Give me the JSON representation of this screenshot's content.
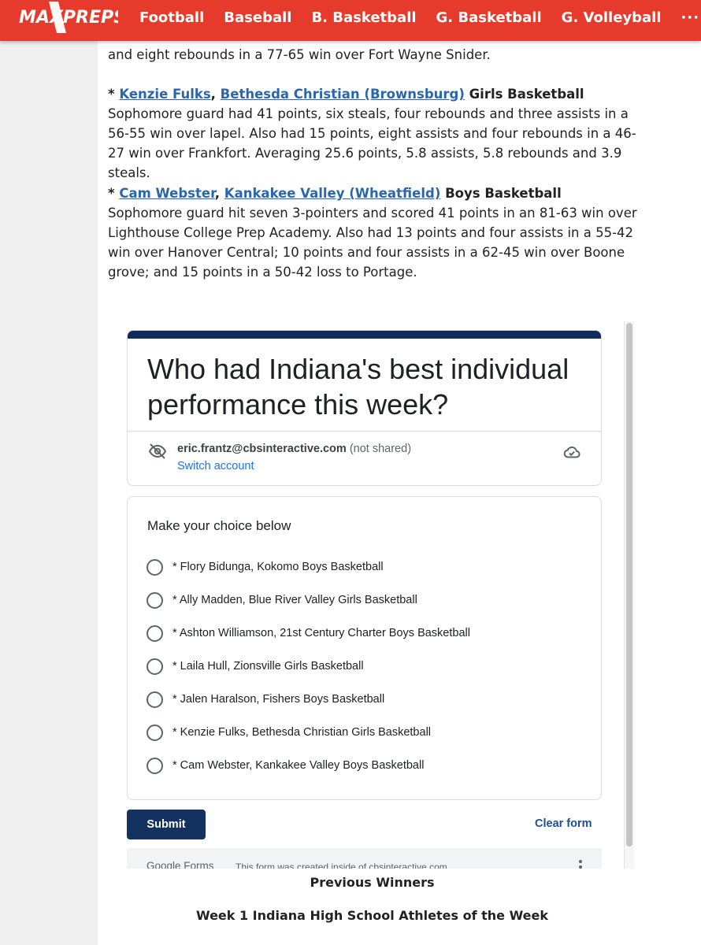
{
  "nav": {
    "logo": "MAXPREPS",
    "items": [
      "Football",
      "Baseball",
      "B. Basketball",
      "G. Basketball",
      "G. Volleyball"
    ],
    "more": "···"
  },
  "article": {
    "top_line": "and eight rebounds in a 77-65 win over Fort Wayne Snider.",
    "entries": [
      {
        "prefix": "* ",
        "athlete": "Kenzie Fulks",
        "sep": ", ",
        "school": "Bethesda Christian (Brownsburg)",
        "sport": " Girls Basketball",
        "text": "Sophomore guard had 41 points, six steals, four rebounds and three assists in a 56-55 win over lapel. Also had 15 points, eight assists and four rebounds in a 46-27 win over Frankfort. Averaging 25.6 points, 5.8 assists, 5.8 rebounds and 3.9 steals."
      },
      {
        "prefix": "* ",
        "athlete": "Cam Webster",
        "sep": ", ",
        "school": "Kankakee Valley (Wheatfield)",
        "sport": " Boys Basketball",
        "text": "Sophomore guard hit seven 3-pointers and scored 41 points in an 81-63 win over Lighthouse College Prep Academy. Also had 13 points and four assists in a 55-42 win over Hanover Central; 10 points and four assists in a 62-45 win over Boone grove; and 15 points in a 50-42 loss to Portage."
      }
    ]
  },
  "form": {
    "title": "Who had Indiana's best individual performance this week?",
    "account_email": "eric.frantz@cbsinteractive.com",
    "account_note": " (not shared)",
    "switch_account": "Switch account",
    "question": "Make your choice below",
    "options": [
      "* Flory Bidunga, Kokomo Boys Basketball",
      "* Ally Madden, Blue River Valley Girls Basketball",
      "* Ashton Williamson, 21st Century Charter Boys Basketball",
      "* Laila Hull, Zionsville Girls Basketball",
      "* Jalen Haralson, Fishers Boys Basketball",
      "* Kenzie Fulks, Bethesda Christian Girls Basketball",
      "* Cam Webster, Kankakee Valley Boys Basketball"
    ],
    "submit": "Submit",
    "clear": "Clear form",
    "footer_logo": "Google Forms",
    "footer_note": "This form was created inside of cbsinteractive.com."
  },
  "headings": {
    "previous_winners": "Previous Winners",
    "week1": "Week 1 Indiana High School Athletes of the Week"
  },
  "colors": {
    "nav_red": "#e63a2c",
    "link_blue": "#2a66b0",
    "form_navy": "#0e2b5c",
    "submit_navy": "#14325f"
  }
}
